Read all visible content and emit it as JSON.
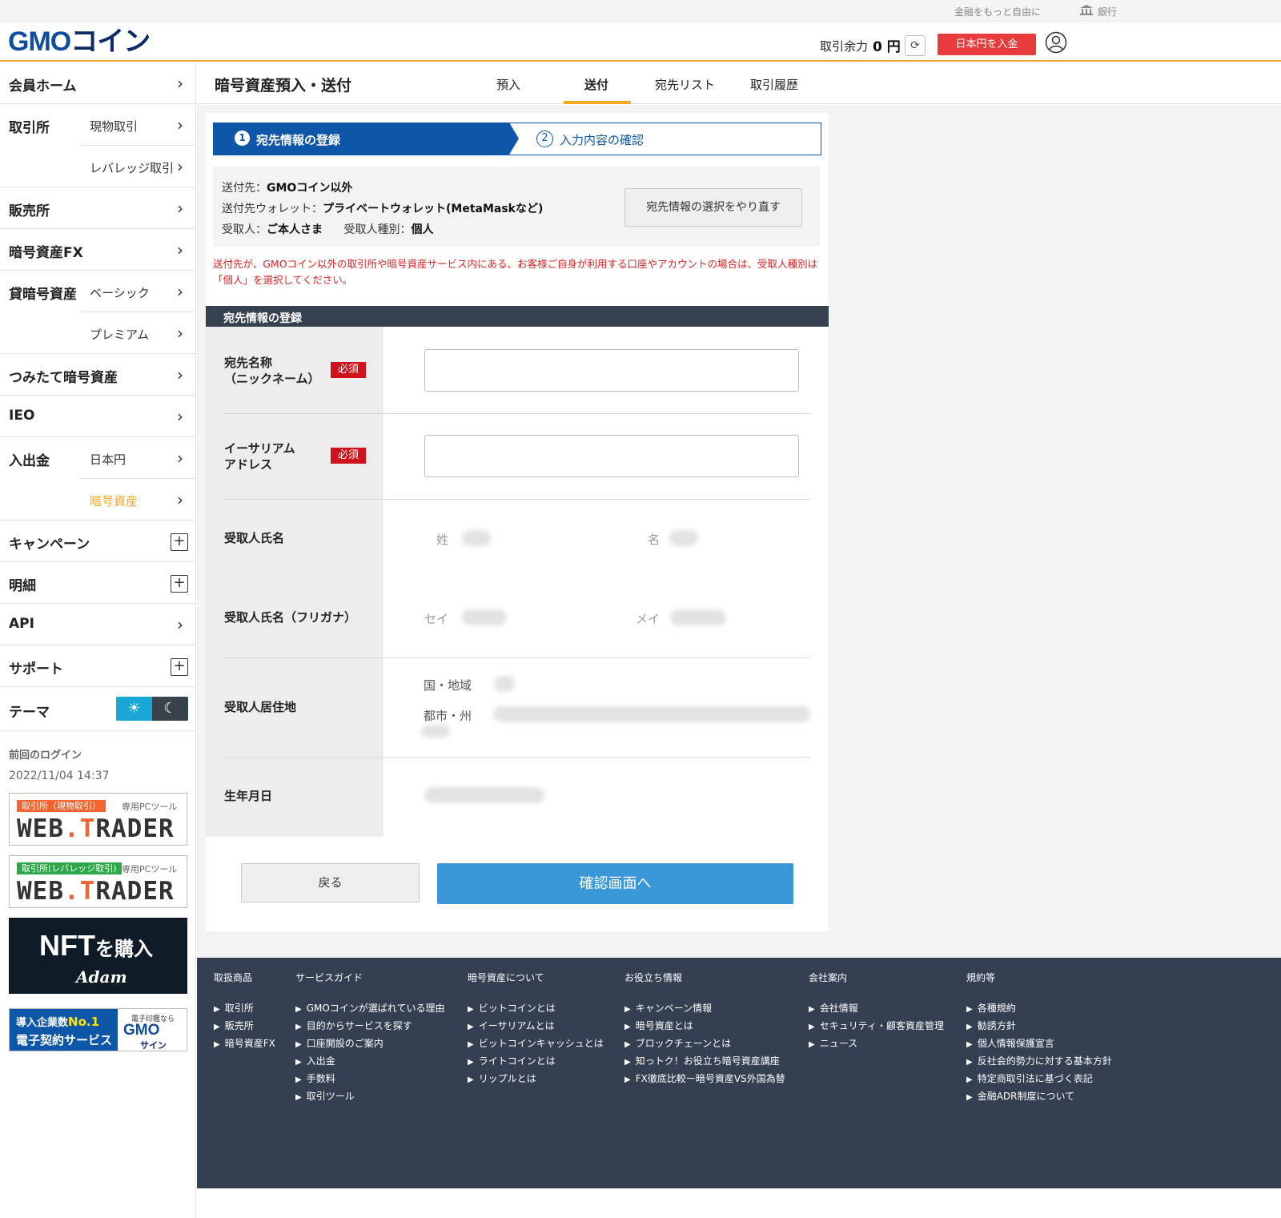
{
  "topbar": {
    "slogan": "金融をもっと自由に",
    "bank": "銀行"
  },
  "header": {
    "logo_main": "GMO",
    "logo_coin": "コイン",
    "balance_label": "取引余力",
    "balance_value": "0 円",
    "deposit_button": "日本円を入金"
  },
  "sidebar": {
    "home": "会員ホーム",
    "exchange": "取引所",
    "exchange_spot": "現物取引",
    "exchange_leverage": "レバレッジ取引",
    "sales": "販売所",
    "fx": "暗号資産FX",
    "lending": "貸暗号資産",
    "lending_basic": "ベーシック",
    "lending_premium": "プレミアム",
    "tsumitate": "つみたて暗号資産",
    "ieo": "IEO",
    "inout": "入出金",
    "inout_jpy": "日本円",
    "inout_crypto": "暗号資産",
    "campaign": "キャンペーン",
    "statement": "明細",
    "api": "API",
    "support": "サポート",
    "theme": "テーマ",
    "last_login_label": "前回のログイン",
    "last_login_value": "2022/11/04 14:37"
  },
  "banners": {
    "wt1_tag": "取引所（現物取引）",
    "wt1_tool": "専用PCツール",
    "wt2_tag": "取引所(レバレッジ取引)",
    "wt2_tool": "専用PCツール",
    "wt_a": "WEB",
    "wt_dot": ".T",
    "wt_b": "RADER",
    "nft_big": "NFT",
    "nft_small": "を購入",
    "nft_brand": "Adam",
    "sign_l1_pre": "導入企業数",
    "sign_l1_no": "No.1",
    "sign_l2": "電子契約サービス",
    "sign_r1": "電子印鑑なら",
    "sign_r2": "GMO",
    "sign_r3": "サイン"
  },
  "page": {
    "title": "暗号資産預入・送付",
    "tabs": [
      "預入",
      "送付",
      "宛先リスト",
      "取引履歴"
    ]
  },
  "steps": {
    "step1_num": "1",
    "step1": "宛先情報の登録",
    "step2_num": "2",
    "step2": "入力内容の確認"
  },
  "summary": {
    "dest_label": "送付先：",
    "dest_value": "GMOコイン以外",
    "wallet_label": "送付先ウォレット：",
    "wallet_value": "プライベートウォレット(MetaMaskなど)",
    "recipient_label": "受取人：",
    "recipient_value": "ご本人さま",
    "type_label": "受取人種別：",
    "type_value": "個人",
    "reselect_button": "宛先情報の選択をやり直す"
  },
  "note": "送付先が、GMOコイン以外の取引所や暗号資産サービス内にある、お客様ご自身が利用する口座やアカウントの場合は、受取人種別は「個人」を選択してください。",
  "form": {
    "section_title": "宛先情報の登録",
    "required": "必須",
    "nickname_label_1": "宛先名称",
    "nickname_label_2": "（ニックネーム）",
    "address_label_1": "イーサリアム",
    "address_label_2": "アドレス",
    "name_label": "受取人氏名",
    "last_name": "姓",
    "first_name": "名",
    "kana_label": "受取人氏名（フリガナ）",
    "last_kana": "セイ",
    "first_kana": "メイ",
    "residence_label": "受取人居住地",
    "country": "国・地域",
    "city": "都市・州",
    "birth_label": "生年月日",
    "back_button": "戻る",
    "confirm_button": "確認画面へ"
  },
  "footer": {
    "columns": [
      {
        "title": "取扱商品",
        "items": [
          "取引所",
          "販売所",
          "暗号資産FX"
        ]
      },
      {
        "title": "サービスガイド",
        "items": [
          "GMOコインが選ばれている理由",
          "目的からサービスを探す",
          "口座開設のご案内",
          "入出金",
          "手数料",
          "取引ツール"
        ]
      },
      {
        "title": "暗号資産について",
        "items": [
          "ビットコインとは",
          "イーサリアムとは",
          "ビットコインキャッシュとは",
          "ライトコインとは",
          "リップルとは"
        ]
      },
      {
        "title": "お役立ち情報",
        "items": [
          "キャンペーン情報",
          "暗号資産とは",
          "ブロックチェーンとは",
          "知っトク！お役立ち暗号資産講座",
          "FX徹底比較ー暗号資産VS外国為替"
        ]
      },
      {
        "title": "会社案内",
        "items": [
          "会社情報",
          "セキュリティ・顧客資産管理",
          "ニュース"
        ]
      },
      {
        "title": "規約等",
        "items": [
          "各種規約",
          "勧誘方針",
          "個人情報保護宣言",
          "反社会的勢力に対する基本方針",
          "特定商取引法に基づく表記",
          "金融ADR制度について"
        ]
      }
    ]
  },
  "colors": {
    "brand_blue": "#0d56a8",
    "accent_orange": "#f5a623",
    "deposit_red": "#e83b3b",
    "confirm_blue": "#3a98d8",
    "footer_bg": "#343f52"
  }
}
